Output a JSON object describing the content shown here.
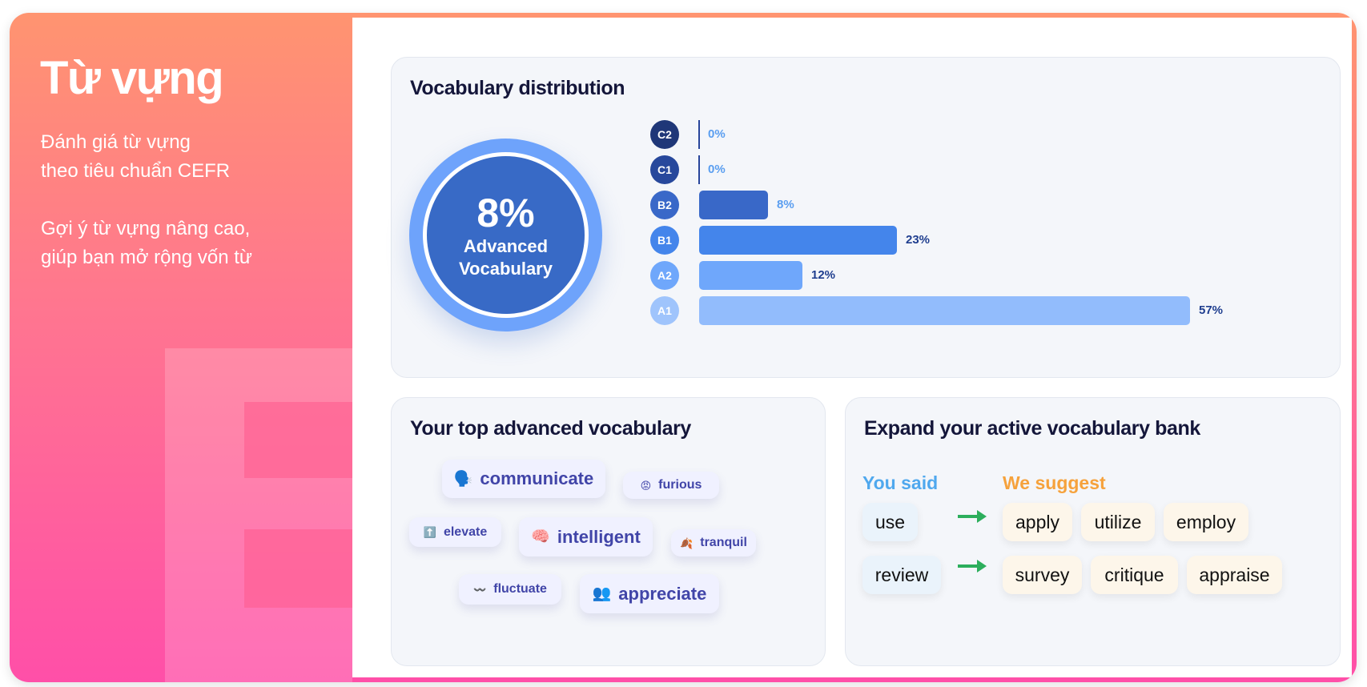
{
  "sidebar": {
    "title": "Từ vựng",
    "desc1": "Đánh giá từ vựng\ntheo tiêu chuẩn CEFR",
    "desc2": "Gợi ý từ vựng nâng cao,\ngiúp bạn mở rộng vốn từ"
  },
  "distribution": {
    "title": "Vocabulary distribution",
    "advanced_pct": "8%",
    "advanced_label": "Advanced\nVocabulary",
    "levels": [
      {
        "level": "C2",
        "value": 0,
        "label": "0%",
        "badge_color": "#1f3778",
        "bar_color": "#28459b",
        "label_color": "#5a9ef0"
      },
      {
        "level": "C1",
        "value": 0,
        "label": "0%",
        "badge_color": "#27489c",
        "bar_color": "#28459b",
        "label_color": "#5a9ef0"
      },
      {
        "level": "B2",
        "value": 8,
        "label": "8%",
        "badge_color": "#3968c8",
        "bar_color": "#3968c8",
        "label_color": "#5a9ef0"
      },
      {
        "level": "B1",
        "value": 23,
        "label": "23%",
        "badge_color": "#4485eb",
        "bar_color": "#4485eb",
        "label_color": "#1f3e8f"
      },
      {
        "level": "A2",
        "value": 12,
        "label": "12%",
        "badge_color": "#6fa7fb",
        "bar_color": "#6fa7fb",
        "label_color": "#1f3e8f"
      },
      {
        "level": "A1",
        "value": 57,
        "label": "57%",
        "badge_color": "#9fc4fc",
        "bar_color": "#92bcfc",
        "label_color": "#1f3e8f"
      }
    ]
  },
  "top_vocab": {
    "title": "Your top advanced vocabulary",
    "words": [
      {
        "word": "communicate",
        "icon": "🗣️",
        "icon_name": "speaking-head-icon"
      },
      {
        "word": "furious",
        "icon": "😡",
        "icon_name": "angry-face-icon"
      },
      {
        "word": "elevate",
        "icon": "⬆️",
        "icon_name": "up-arrow-icon"
      },
      {
        "word": "intelligent",
        "icon": "🧠",
        "icon_name": "brain-icon"
      },
      {
        "word": "tranquil",
        "icon": "🍂",
        "icon_name": "fallen-leaf-icon"
      },
      {
        "word": "fluctuate",
        "icon": "〰️",
        "icon_name": "wavy-dash-icon"
      },
      {
        "word": "appreciate",
        "icon": "👥",
        "icon_name": "people-icon"
      }
    ]
  },
  "expand": {
    "title": "Expand your active vocabulary bank",
    "you_said_label": "You said",
    "we_suggest_label": "We suggest",
    "you_said_color": "#4fa8ee",
    "we_suggest_color": "#f6a23c",
    "rows": [
      {
        "said": "use",
        "suggestions": [
          "apply",
          "utilize",
          "employ"
        ]
      },
      {
        "said": "review",
        "suggestions": [
          "survey",
          "critique",
          "appraise"
        ]
      }
    ]
  }
}
